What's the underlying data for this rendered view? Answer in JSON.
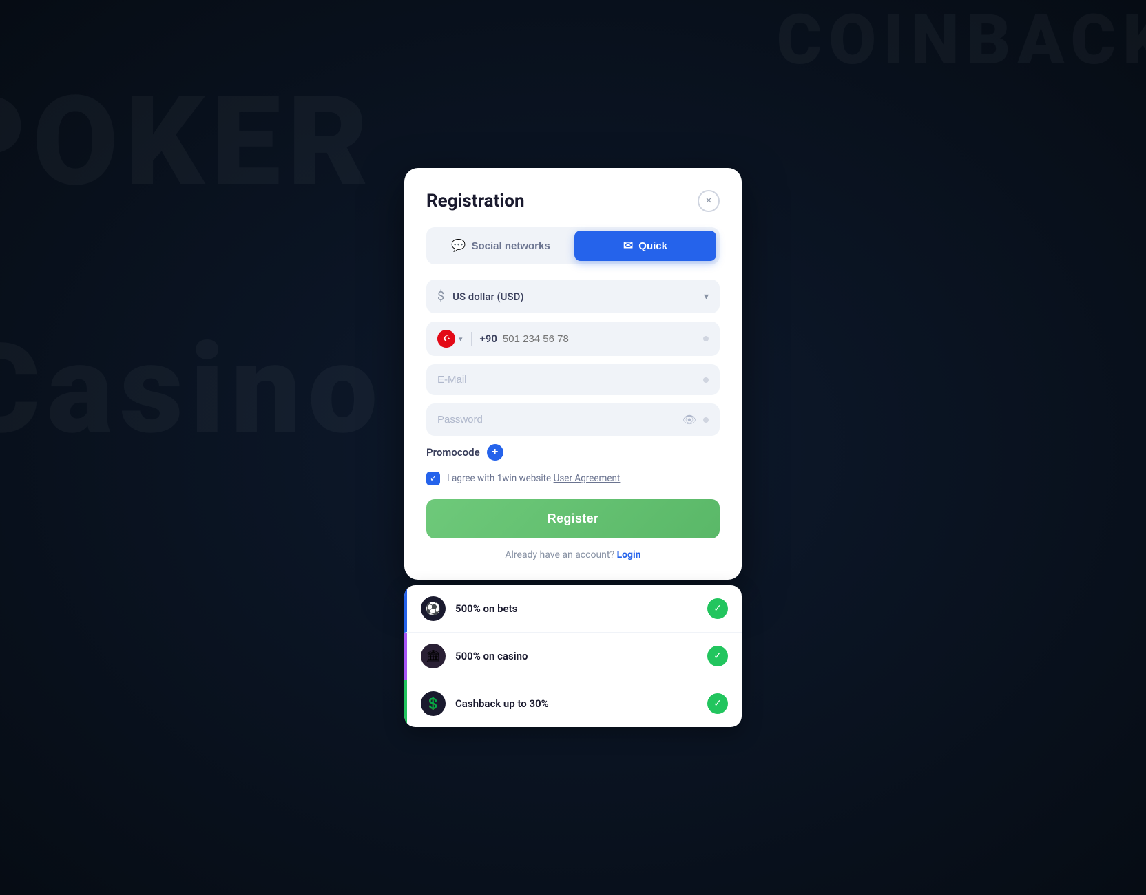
{
  "background": {
    "text1": "POKER",
    "text2": "Casino",
    "text3": "COINBACK"
  },
  "modal": {
    "title": "Registration",
    "close_label": "×",
    "tabs": [
      {
        "id": "social",
        "label": "Social networks",
        "icon": "💬",
        "active": false
      },
      {
        "id": "quick",
        "label": "Quick",
        "icon": "✉",
        "active": true
      }
    ],
    "currency": {
      "icon": "$",
      "label": "US dollar (USD)",
      "placeholder": "US dollar (USD)"
    },
    "phone": {
      "country_code": "+90",
      "placeholder": "501 234 56 78"
    },
    "email": {
      "placeholder": "E-Mail"
    },
    "password": {
      "placeholder": "Password"
    },
    "promocode": {
      "label": "Promocode",
      "add_label": "+"
    },
    "agreement": {
      "text": "I agree with 1win website ",
      "link_text": "User Agreement",
      "checked": true
    },
    "register_button": "Register",
    "login_text": "Already have an account?",
    "login_link": "Login"
  },
  "bonus": {
    "items": [
      {
        "icon": "⚽",
        "text": "500% on bets"
      },
      {
        "icon": "🏛",
        "text": "500% on casino"
      },
      {
        "icon": "💲",
        "text": "Cashback up to 30%"
      }
    ]
  }
}
